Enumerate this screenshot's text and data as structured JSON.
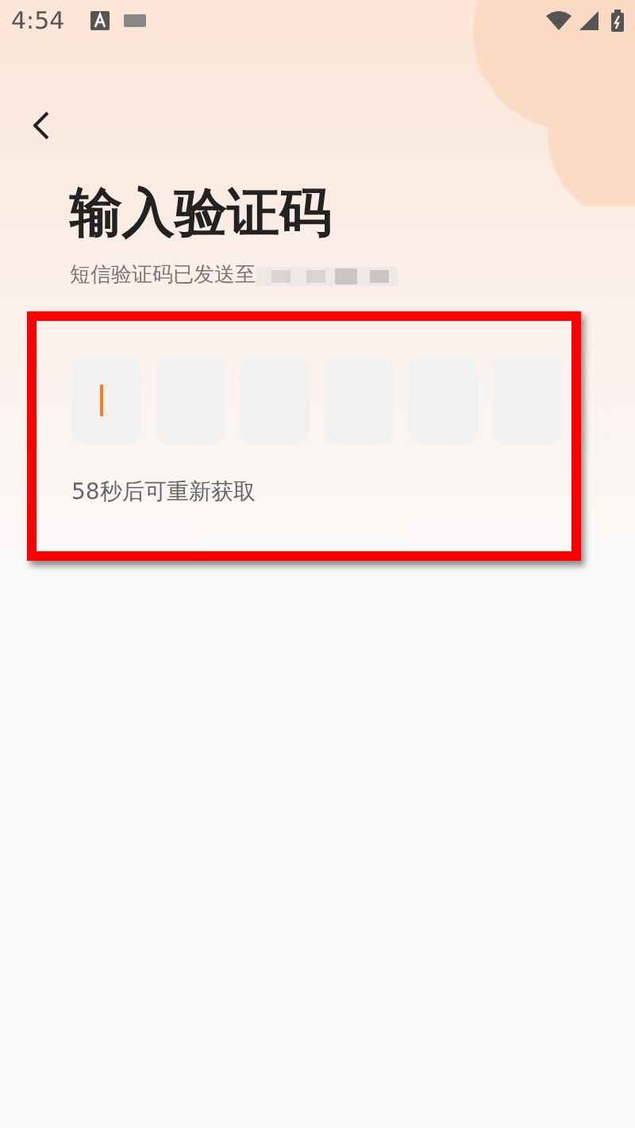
{
  "status_bar": {
    "time": "4:54"
  },
  "title": "输入验证码",
  "subtitle": "短信验证码已发送至",
  "code_boxes": [
    {
      "focused": true
    },
    {
      "focused": false
    },
    {
      "focused": false
    },
    {
      "focused": false
    },
    {
      "focused": false
    },
    {
      "focused": false
    }
  ],
  "resend_countdown": "58秒后可重新获取"
}
